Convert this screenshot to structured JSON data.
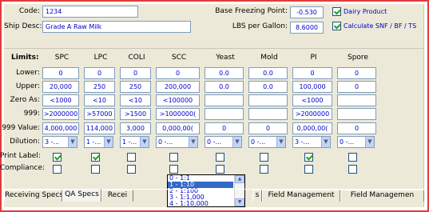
{
  "header": {
    "code_label": "Code:",
    "code_value": "1234",
    "ship_desc_label": "Ship Desc:",
    "ship_desc_value": "Grade A Raw Milk",
    "base_freezing_label": "Base Freezing Point:",
    "base_freezing_value": "-0.530",
    "lbs_per_gallon_label": "LBS per Gallon:",
    "lbs_per_gallon_value": "8.6000",
    "dairy_product_label": "Dairy Product",
    "dairy_product_checked": true,
    "calc_snf_label": "Calculate SNF / BF / TS",
    "calc_snf_checked": true
  },
  "limits": {
    "title": "Limits:",
    "columns": [
      "SPC",
      "LPC",
      "COLI",
      "SCC",
      "Yeast",
      "Mold",
      "PI",
      "Spore"
    ],
    "rows": {
      "lower": {
        "label": "Lower:",
        "values": [
          "0",
          "0",
          "0",
          "0",
          "0.0",
          "0.0",
          "0",
          "0"
        ]
      },
      "upper": {
        "label": "Upper:",
        "values": [
          "20,000",
          "250",
          "250",
          "200,000",
          "0.0",
          "0.0",
          "100,000",
          "0"
        ]
      },
      "zero_as": {
        "label": "Zero As:",
        "values": [
          "<1000",
          "<10",
          "<10",
          "<100000",
          "",
          "",
          "<1000",
          ""
        ]
      },
      "nines": {
        "label": "999:",
        "values": [
          ">2000000",
          ">57000",
          ">1500",
          ">1000000(",
          "",
          "",
          ">2000000",
          ""
        ]
      },
      "nines_value": {
        "label": "999 Value:",
        "values": [
          "4,000,000",
          "114,000",
          "3,000",
          "0,000,00(",
          "0",
          "0",
          "0,000,00(",
          "0"
        ]
      }
    },
    "dilution": {
      "label": "Dilution:",
      "values": [
        "3 -...",
        "1 -...",
        "1 -...",
        "0 -...",
        "0 -...",
        "0 -...",
        "3 -...",
        "0 -..."
      ]
    },
    "print_label": {
      "label": "Print Label:",
      "checked": [
        true,
        true,
        false,
        false,
        false,
        false,
        true,
        false
      ]
    },
    "compliance": {
      "label": "Compliance:",
      "checked": [
        false,
        false,
        false,
        false,
        false,
        false,
        false,
        false
      ]
    }
  },
  "dilution_dropdown": {
    "options": [
      "0 - 1:1",
      "1 - 1:10",
      "2 - 1:100",
      "3 - 1:1,000",
      "4 - 1:10,000"
    ],
    "selected_index": 1
  },
  "tabs": [
    {
      "label": "Receiving Specs",
      "active": false
    },
    {
      "label": "QA Specs",
      "active": true
    },
    {
      "label": "Recei",
      "active": false
    },
    {
      "label": "s",
      "active": false
    },
    {
      "label": "Field Management",
      "active": false
    },
    {
      "label": "Field Managemen",
      "active": false
    }
  ],
  "colors": {
    "frame_border": "#e23b3b",
    "panel_bg": "#ece9d8",
    "field_text": "#0000cc",
    "selection": "#316ac5"
  }
}
